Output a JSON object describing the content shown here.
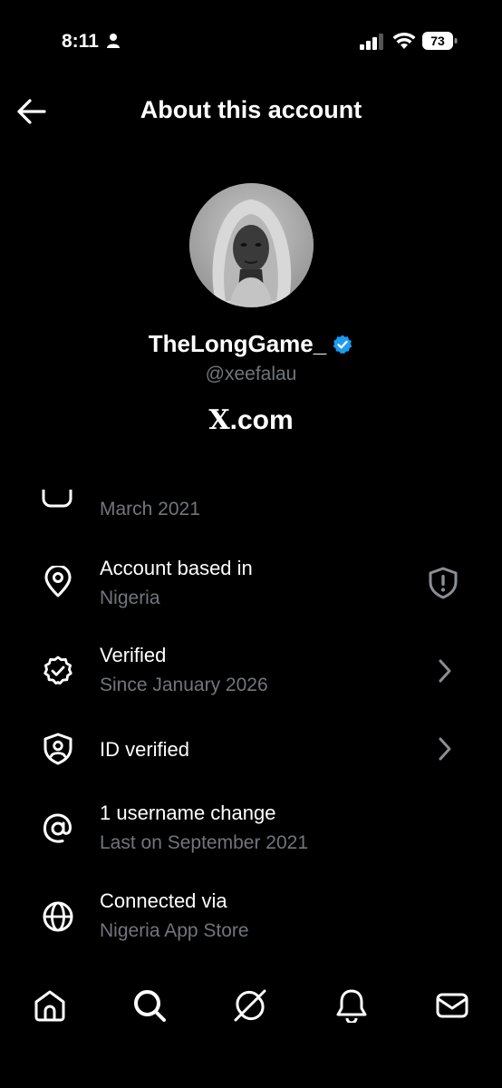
{
  "status_bar": {
    "time": "8:11",
    "battery": "73"
  },
  "header": {
    "title": "About this account"
  },
  "profile": {
    "display_name": "TheLongGame_",
    "handle": "@xeefalau",
    "site_x": "X",
    "site_rest": ".com"
  },
  "rows": [
    {
      "id": "joined",
      "icon": "calendar-icon",
      "title": "",
      "subtitle": "March 2021"
    },
    {
      "id": "location",
      "icon": "location-pin-icon",
      "title": "Account based in",
      "subtitle": "Nigeria",
      "trailing": "shield-alert-icon"
    },
    {
      "id": "verified",
      "icon": "verified-badge-icon",
      "title": "Verified",
      "subtitle": "Since January 2026",
      "trailing": "chevron-right-icon"
    },
    {
      "id": "id-verified",
      "icon": "id-shield-icon",
      "title": "ID verified",
      "subtitle": "",
      "trailing": "chevron-right-icon"
    },
    {
      "id": "username",
      "icon": "at-sign-icon",
      "title": "1 username change",
      "subtitle": "Last on September 2021"
    },
    {
      "id": "connected",
      "icon": "globe-icon",
      "title": "Connected via",
      "subtitle": "Nigeria App Store"
    }
  ],
  "bottom_nav": [
    "home-icon",
    "search-icon",
    "grok-icon",
    "notifications-icon",
    "messages-icon"
  ],
  "colors": {
    "background": "#000000",
    "primary_text": "#e7e9ea",
    "secondary_text": "#71767b",
    "verified_blue": "#1d9bf0"
  }
}
